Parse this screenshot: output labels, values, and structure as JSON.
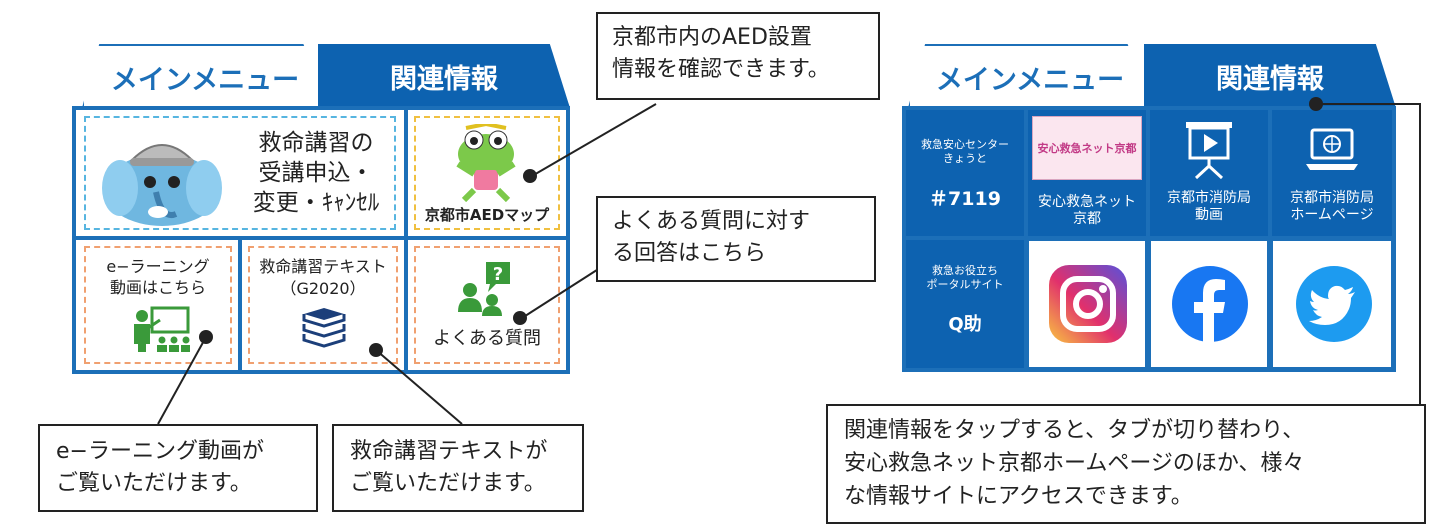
{
  "left_panel": {
    "tab_main": "メインメニュー",
    "tab_related": "関連情報",
    "course_line1": "救命講習の",
    "course_line2": "受講申込・",
    "course_line3": "変更・ｷｬﾝｾﾙ",
    "aed_label": "京都市AEDマップ",
    "elearn_line1": "e−ラーニング",
    "elearn_line2": "動画はこちら",
    "text_line1": "救命講習テキスト",
    "text_line2": "（G2020）",
    "faq_label": "よくある質問",
    "faq_icon_mark": "?"
  },
  "right_panel": {
    "tab_main": "メインメニュー",
    "tab_related": "関連情報",
    "center_line1": "救急安心センター",
    "center_line2": "きょうと",
    "center_number": "＃7119",
    "net_logo_text": "安心救急ネット京都",
    "net_line1": "安心救急ネット",
    "net_line2": "京都",
    "video_line1": "京都市消防局",
    "video_line2": "動画",
    "home_line1": "京都市消防局",
    "home_line2": "ホームページ",
    "portal_line1": "救急お役立ち",
    "portal_line2": "ポータルサイト",
    "portal_name": "Q助"
  },
  "callouts": {
    "aed_line1": "京都市内のAED設置",
    "aed_line2": "情報を確認できます。",
    "faq_line1": "よくある質問に対す",
    "faq_line2": "る回答はこちら",
    "elearn_line1": "e−ラーニング動画が",
    "elearn_line2": "ご覧いただけます。",
    "text_line1": "救命講習テキストが",
    "text_line2": "ご覧いただけます。",
    "related_line1": "関連情報をタップすると、タブが切り替わり、",
    "related_line2": "安心救急ネット京都ホームページのほか、様々",
    "related_line3": "な情報サイトにアクセスできます。"
  },
  "colors": {
    "panel_blue": "#1c6fb8",
    "tab_blue": "#0d62b0",
    "callout_border": "#222222"
  },
  "icons": {
    "elephant": "elephant-mascot-icon",
    "frog": "frog-mascot-icon",
    "teacher": "teacher-board-icon",
    "books": "books-icon",
    "faq": "question-people-icon",
    "video": "video-screen-icon",
    "laptop": "laptop-globe-icon",
    "instagram": "instagram-icon",
    "facebook": "facebook-icon",
    "twitter": "twitter-icon"
  }
}
